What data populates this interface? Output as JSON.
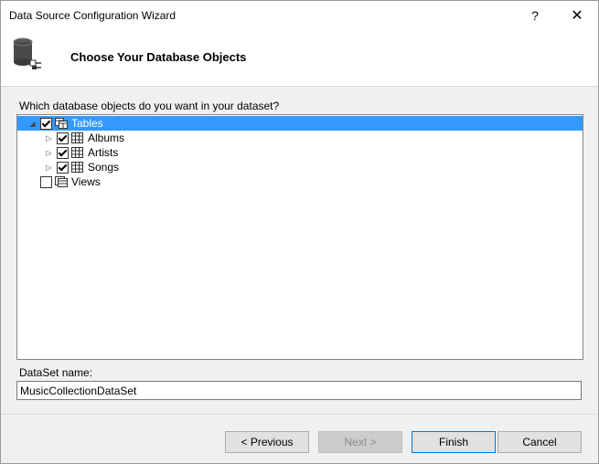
{
  "window": {
    "title": "Data Source Configuration Wizard",
    "help_glyph": "?",
    "close_glyph": "✕"
  },
  "header": {
    "title": "Choose Your Database Objects",
    "icon": "database-icon"
  },
  "tree": {
    "prompt": "Which database objects do you want in your dataset?",
    "root": {
      "label": "Tables",
      "checked": true,
      "expanded": true,
      "selected": true
    },
    "tables": [
      {
        "label": "Albums",
        "checked": true
      },
      {
        "label": "Artists",
        "checked": true
      },
      {
        "label": "Songs",
        "checked": true
      }
    ],
    "views": {
      "label": "Views",
      "checked": false
    }
  },
  "dataset": {
    "label": "DataSet name:",
    "value": "MusicCollectionDataSet"
  },
  "buttons": {
    "previous": "< Previous",
    "next": "Next >",
    "finish": "Finish",
    "cancel": "Cancel"
  },
  "colors": {
    "selection": "#3399ff",
    "default_border": "#0078d7"
  }
}
